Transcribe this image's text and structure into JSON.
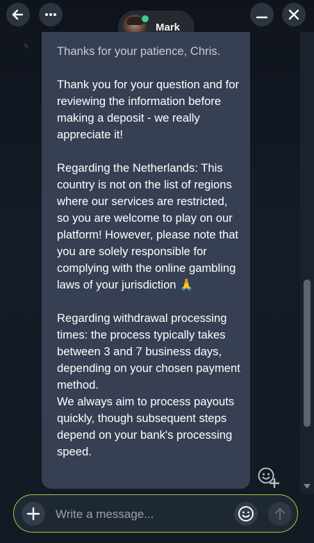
{
  "header": {
    "contact_name": "Mark",
    "contact_status": "online",
    "icons": {
      "back": "arrow-left-icon",
      "more": "more-horizontal-icon",
      "minimize": "minimize-icon",
      "close": "close-icon"
    }
  },
  "message": {
    "first_line": "Thanks for your patience, Chris.",
    "paragraphs": [
      "Thank you for your question and for reviewing the information before making a deposit - we really appreciate it!",
      "Regarding the Netherlands: This country is not on the list of regions where our services are restricted, so you are welcome to play on our platform! However, please note that you are solely responsible for complying with the online gambling laws of your jurisdiction 🙏",
      "Regarding withdrawal processing times: the process typically takes between 3 and 7 business days, depending on your chosen payment method.\nWe always aim to process payouts quickly, though subsequent steps depend on your bank's processing speed."
    ],
    "reaction_icon": "add-reaction-icon"
  },
  "composer": {
    "placeholder": "Write a message...",
    "value": "",
    "icons": {
      "add": "plus-icon",
      "emoji": "smiley-icon",
      "send": "arrow-up-icon"
    }
  },
  "colors": {
    "background": "#121923",
    "bubble": "#364052",
    "accent_border": "#9bd048",
    "online": "#3fcf86"
  }
}
